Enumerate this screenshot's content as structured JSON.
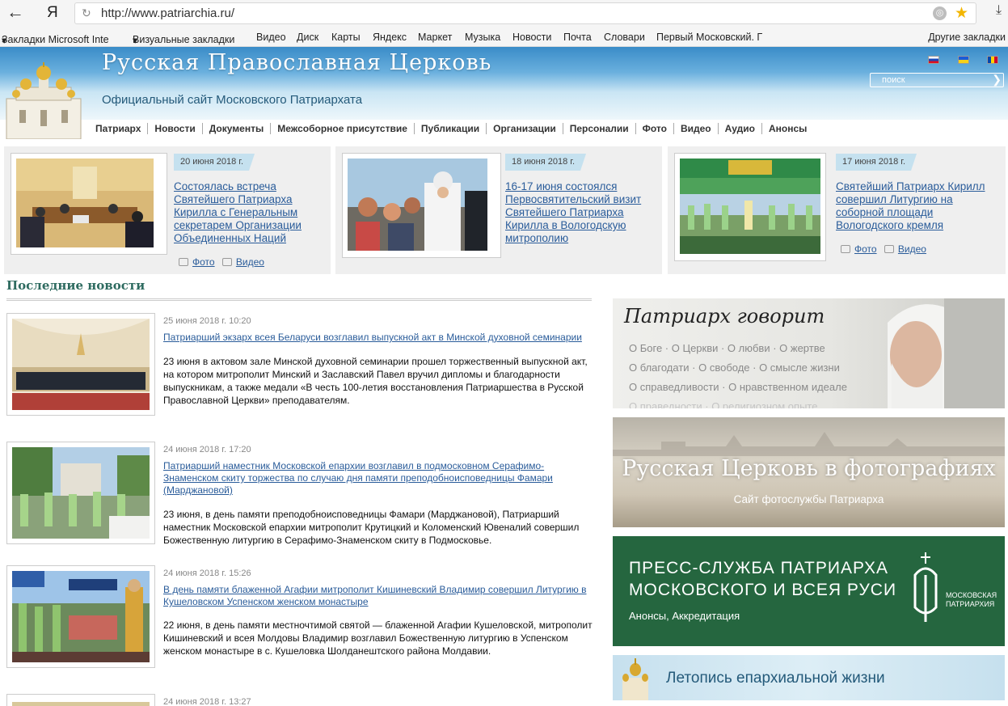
{
  "browser": {
    "logo": "Я",
    "url": "http://www.patriarchia.ru/",
    "bookmarks": [
      "Закладки Microsoft Inte",
      "Визуальные закладки",
      "Видео",
      "Диск",
      "Карты",
      "Яндекс",
      "Маркет",
      "Музыка",
      "Новости",
      "Почта",
      "Словари",
      "Первый Московский. Г"
    ],
    "other_bookmarks": "Другие закладки"
  },
  "site": {
    "title": "Русская Православная Церковь",
    "subtitle": "Официальный сайт Московского Патриархата",
    "search_placeholder": "поиск",
    "nav": [
      "Патриарх",
      "Новости",
      "Документы",
      "Межсоборное присутствие",
      "Публикации",
      "Организации",
      "Персоналии",
      "Фото",
      "Видео",
      "Аудио",
      "Анонсы"
    ]
  },
  "featured": [
    {
      "date": "20 июня 2018 г.",
      "title": "Состоялась встреча Святейшего Патриарха Кирилла с Генеральным секретарем Организации Объединенных Наций",
      "photo": "Фото",
      "video": "Видео"
    },
    {
      "date": "18 июня 2018 г.",
      "title": "16-17 июня состоялся Первосвятительский визит Святейшего Патриарха Кирилла в Вологодскую митрополию"
    },
    {
      "date": "17 июня 2018 г.",
      "title": "Святейший Патриарх Кирилл совершил Литургию на соборной площади Вологодского кремля",
      "photo": "Фото",
      "video": "Видео"
    }
  ],
  "latest": {
    "heading": "Последние новости",
    "items": [
      {
        "date": "25 июня 2018 г. 10:20",
        "title": "Патриарший экзарх всея Беларуси возглавил выпускной акт в Минской духовной семинарии",
        "body": "23 июня в актовом зале Минской духовной семинарии прошел торжественный выпускной акт, на котором митрополит Минский и Заславский Павел вручил дипломы и благодарности выпускникам, а также медали «В честь 100-летия восстановления Патриаршества в Русской Православной Церкви» преподавателям."
      },
      {
        "date": "24 июня 2018 г. 17:20",
        "title": "Патриарший наместник Московской епархии возглавил в подмосковном Серафимо-Знаменском скиту торжества по случаю дня памяти преподобноисповедницы Фамари (Марджановой)",
        "body": "23 июня, в день памяти преподобноисповедницы Фамари (Марджановой), Патриарший наместник Московской епархии митрополит Крутицкий и Коломенский Ювеналий совершил Божественную литургию в Серафимо-Знаменском скиту в Подмосковье."
      },
      {
        "date": "24 июня 2018 г. 15:26",
        "title": "В день памяти блаженной Агафии митрополит Кишиневский Владимир совершил Литургию в Кушеловском Успенском женском монастыре",
        "body": "22 июня, в день памяти местночтимой святой — блаженной Агафии Кушеловской, митрополит Кишиневский и всея Молдовы Владимир возглавил Божественную литургию в Успенском женском монастыре в с. Кушеловка Шолданештского района Молдавии."
      },
      {
        "date": "24 июня 2018 г. 13:27"
      }
    ]
  },
  "banners": {
    "patriarch": {
      "title": "Патриарх говорит",
      "row1": "О Боге · О Церкви · О любви · О жертве",
      "row2": "О благодати · О свободе · О смысле жизни",
      "row3": "О справедливости · О нравственном идеале",
      "row4": "О праведности · О религиозном опыте"
    },
    "photos": {
      "title": "Русская Церковь в фотографиях",
      "subtitle": "Сайт фотослужбы Патриарха"
    },
    "press": {
      "line1": "ПРЕСС-СЛУЖБА ПАТРИАРХА",
      "line2": "МОСКОВСКОГО И ВСЕЯ РУСИ",
      "subtitle": "Анонсы, Аккредитация",
      "logo_text": "МОСКОВСКАЯ ПАТРИАРХИЯ"
    },
    "chronicle": {
      "title": "Летопись епархиальной жизни"
    }
  },
  "colors": {
    "accent_link": "#2a5c9a",
    "press_green": "#25663f",
    "header_blue": "#3a8cc8"
  }
}
